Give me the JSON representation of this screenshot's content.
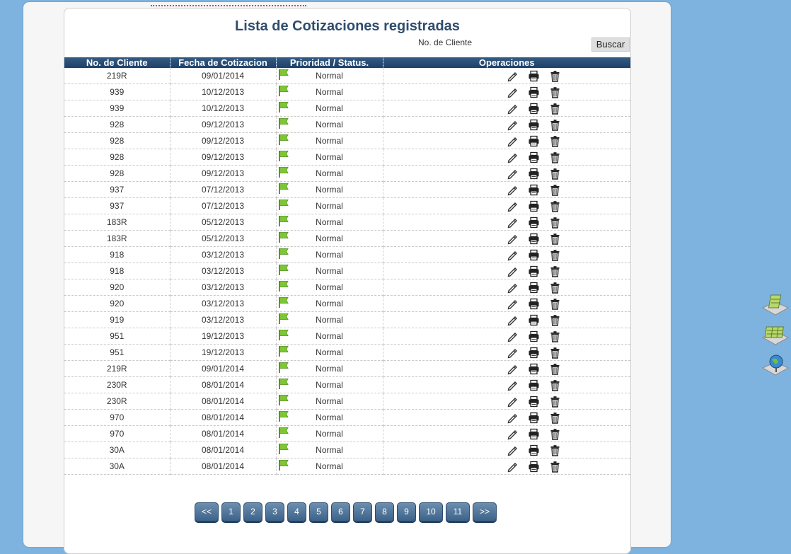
{
  "page": {
    "title": "Lista de Cotizaciones registradas",
    "search_label": "No. de Cliente",
    "search_button": "Buscar"
  },
  "columns": [
    "No. de Cliente",
    "Fecha de Cotizacion",
    "Prioridad / Status.",
    "Operaciones"
  ],
  "rows": [
    {
      "client": "219R",
      "date": "09/01/2014",
      "status": "Normal"
    },
    {
      "client": "939",
      "date": "10/12/2013",
      "status": "Normal"
    },
    {
      "client": "939",
      "date": "10/12/2013",
      "status": "Normal"
    },
    {
      "client": "928",
      "date": "09/12/2013",
      "status": "Normal"
    },
    {
      "client": "928",
      "date": "09/12/2013",
      "status": "Normal"
    },
    {
      "client": "928",
      "date": "09/12/2013",
      "status": "Normal"
    },
    {
      "client": "928",
      "date": "09/12/2013",
      "status": "Normal"
    },
    {
      "client": "937",
      "date": "07/12/2013",
      "status": "Normal"
    },
    {
      "client": "937",
      "date": "07/12/2013",
      "status": "Normal"
    },
    {
      "client": "183R",
      "date": "05/12/2013",
      "status": "Normal"
    },
    {
      "client": "183R",
      "date": "05/12/2013",
      "status": "Normal"
    },
    {
      "client": "918",
      "date": "03/12/2013",
      "status": "Normal"
    },
    {
      "client": "918",
      "date": "03/12/2013",
      "status": "Normal"
    },
    {
      "client": "920",
      "date": "03/12/2013",
      "status": "Normal"
    },
    {
      "client": "920",
      "date": "03/12/2013",
      "status": "Normal"
    },
    {
      "client": "919",
      "date": "03/12/2013",
      "status": "Normal"
    },
    {
      "client": "951",
      "date": "19/12/2013",
      "status": "Normal"
    },
    {
      "client": "951",
      "date": "19/12/2013",
      "status": "Normal"
    },
    {
      "client": "219R",
      "date": "09/01/2014",
      "status": "Normal"
    },
    {
      "client": "230R",
      "date": "08/01/2014",
      "status": "Normal"
    },
    {
      "client": "230R",
      "date": "08/01/2014",
      "status": "Normal"
    },
    {
      "client": "970",
      "date": "08/01/2014",
      "status": "Normal"
    },
    {
      "client": "970",
      "date": "08/01/2014",
      "status": "Normal"
    },
    {
      "client": "30A",
      "date": "08/01/2014",
      "status": "Normal"
    },
    {
      "client": "30A",
      "date": "08/01/2014",
      "status": "Normal"
    }
  ],
  "row_icons": {
    "priority": "green-flag-icon",
    "edit": "pencil-icon",
    "print": "printer-icon",
    "delete": "trash-icon"
  },
  "pagination": [
    "<<",
    "1",
    "2",
    "3",
    "4",
    "5",
    "6",
    "7",
    "8",
    "9",
    "10",
    "11",
    ">>"
  ],
  "side_icons": [
    "calculator-sheet-icon",
    "spreadsheet-icon",
    "globe-pin-icon"
  ],
  "colors": {
    "header": "#244a72",
    "background": "#7eb3e0",
    "title": "#2e4d6e",
    "flag": "#7cc832"
  }
}
